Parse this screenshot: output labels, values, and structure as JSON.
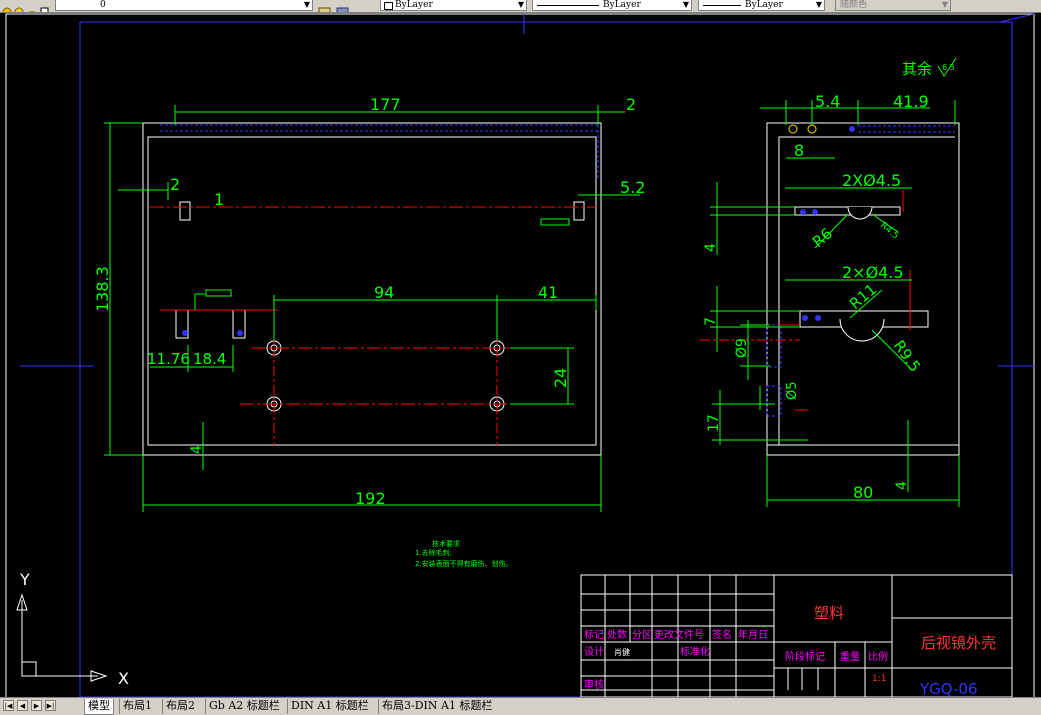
{
  "toolbar": {
    "layer_value": "0",
    "color_value": "ByLayer",
    "linetype_value": "ByLayer",
    "lineweight_value": "ByLayer",
    "plotstyle_value": "随颜色"
  },
  "layout_tabs": [
    {
      "label": "模型",
      "active": true
    },
    {
      "label": "布局1",
      "active": false
    },
    {
      "label": "布局2",
      "active": false
    },
    {
      "label": "Gb A2 标题栏",
      "active": false
    },
    {
      "label": "DIN A1 标题栏",
      "active": false
    },
    {
      "label": "布局3-DIN A1 标题栏",
      "active": false
    }
  ],
  "ucs": {
    "x_label": "X",
    "y_label": "Y"
  },
  "drawing": {
    "roughness_note": "其余",
    "roughness_value": "6.3",
    "front_view": {
      "dims": {
        "width_top": "177",
        "gap_right": "2",
        "offset_left": "2",
        "offset_right": "5.2",
        "callout_one": "1",
        "height": "138.3",
        "hole_spacing": "94",
        "hole_to_edge": "41",
        "slot_offset_a": "11.76",
        "slot_offset_b": "18.4",
        "hole_vertical": "24",
        "bottom_thickness": "4",
        "total_width": "192"
      }
    },
    "side_view": {
      "dims": {
        "top_offset": "5.4",
        "top_length": "41.9",
        "slot_depth": "8",
        "holes_upper": "2XØ4.5",
        "radius_r6": "R6",
        "radius_r45": "R4.5",
        "height_4": "4",
        "holes_lower": "2×Ø4.5",
        "radius_r11": "R11",
        "radius_r95": "R9.5",
        "height_7": "7",
        "dia_9": "Ø9",
        "dia_5": "Ø5",
        "height_17": "17",
        "width_80": "80",
        "bottom_4": "4"
      }
    },
    "tech_notes": {
      "heading": "技术要求",
      "line1": "1.去除毛刺;",
      "line2": "2.安装表面不得有磨伤、划伤。"
    },
    "title_block": {
      "material": "塑料",
      "part_name": "后视镜外壳",
      "drawing_no": "YGQ-06",
      "col_mark": "标记",
      "col_count": "处数",
      "col_zone": "分区",
      "col_change_doc": "更改文件号",
      "col_sign": "签名",
      "col_date": "年月日",
      "design_label": "设计",
      "designer_name": "肖健",
      "standard_label": "标准化",
      "stage_label": "阶段标记",
      "weight_label": "重量",
      "scale_label": "比例",
      "scale_value": "1:1",
      "review_label": "审核"
    }
  },
  "colors": {
    "background": "#000000",
    "outline": "#ffffff",
    "dimension": "#00ff00",
    "centerline": "#ff0000",
    "hidden_blue": "#0000ff",
    "frame_blue": "#3333ff",
    "title_magenta": "#ff00ff",
    "title_red": "#ff3333"
  }
}
